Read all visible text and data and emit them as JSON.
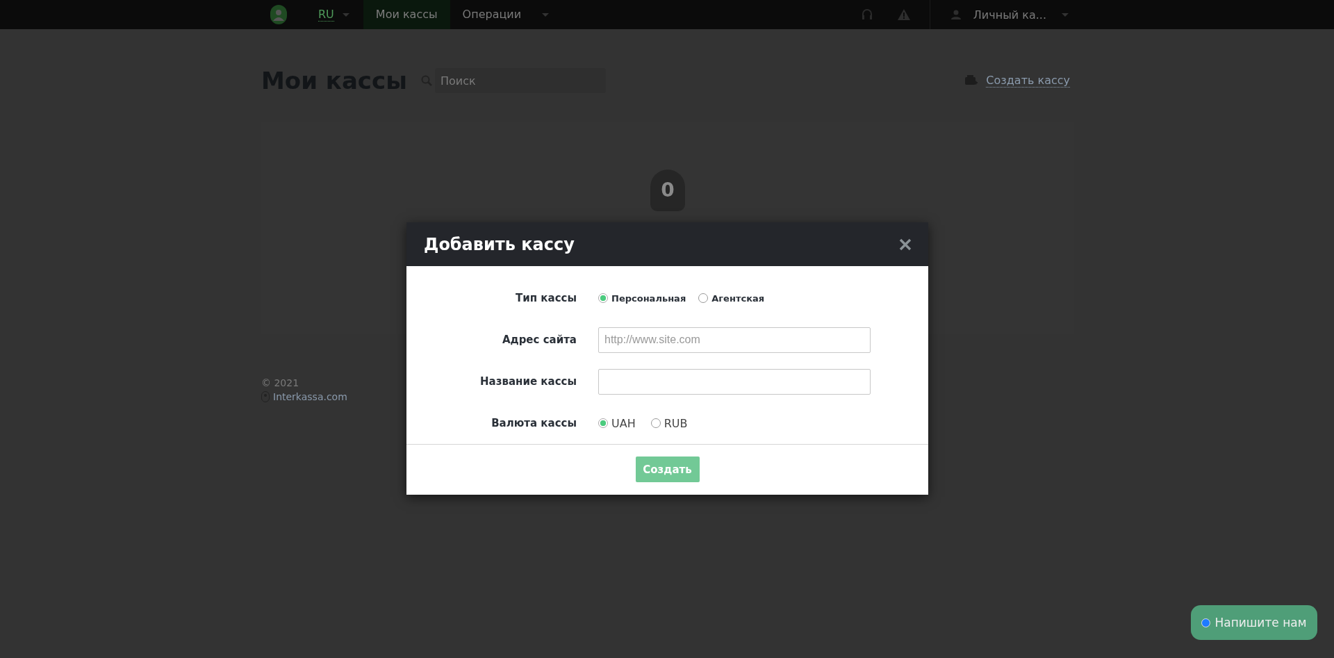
{
  "nav": {
    "language": {
      "label": "RU"
    },
    "tabs": [
      {
        "label": "Мои кассы",
        "selected": true
      },
      {
        "label": "Операции",
        "selected": false
      }
    ],
    "account": {
      "label": "Личный ка..."
    }
  },
  "page": {
    "title": "Мои кассы",
    "search": {
      "placeholder": "Поиск"
    },
    "create_link": "Создать кассу",
    "empty_count": "0",
    "footer": {
      "copyright": "© 2021",
      "link": "Interkassa.com"
    }
  },
  "modal": {
    "title": "Добавить кассу",
    "fields": [
      {
        "kind": "radio",
        "label": "Тип кассы",
        "bold": true,
        "options": [
          {
            "label": "Персональная",
            "selected": true
          },
          {
            "label": "Агентская",
            "selected": false
          }
        ]
      },
      {
        "kind": "text",
        "label": "Адрес сайта",
        "placeholder": "http://www.site.com"
      },
      {
        "kind": "text",
        "label": "Название кассы"
      },
      {
        "kind": "radio",
        "label": "Валюта кассы",
        "bold": false,
        "options": [
          {
            "label": "UAH",
            "selected": true
          },
          {
            "label": "RUB",
            "selected": false
          }
        ]
      }
    ],
    "submit_button": "Создать"
  },
  "chat": {
    "label": "Напишите нам"
  }
}
